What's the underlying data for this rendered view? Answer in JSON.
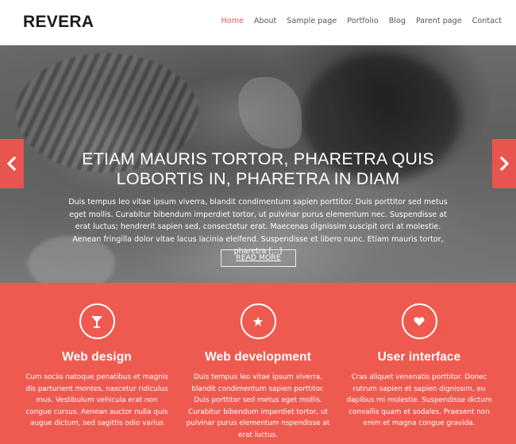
{
  "header": {
    "logo": "REVERA",
    "nav": [
      "Home",
      "About",
      "Sample page",
      "Portfolio",
      "Blog",
      "Parent page",
      "Contact"
    ],
    "active_index": 0
  },
  "slider": {
    "title": "ETIAM MAURIS TORTOR, PHARETRA QUIS LOBORTIS IN, PHARETRA IN DIAM",
    "text": "Duis tempus leo vitae ipsum viverra, blandit condimentum sapien porttitor. Duis porttitor sed metus eget mollis. Curabitur bibendum imperdiet tortor, ut pulvinar purus elementum nec. Suspendisse at erat luctus; hendrerit sapien sed, consectetur erat. Maecenas dignissim suscipit orci at molestie. Aenean fringilla dolor vitae lacus lacinia eleifend. Suspendisse et libero nunc. Etiam mauris tortor, pharetra […]",
    "button": "READ MORE",
    "prev_icon": "chevron-left-icon",
    "next_icon": "chevron-right-icon"
  },
  "features": [
    {
      "icon": "cocktail-glass-icon",
      "title": "Web design",
      "text": "Cum sociis natoque penatibus et magnis dis parturient montes, nascetur ridiculus mus. Vestibulum vehicula erat non congue cursus. Aenean auctor nulla quis augue dictum, sed sagittis odio varius"
    },
    {
      "icon": "star-icon",
      "title": "Web development",
      "text": "Duis tempus leo vitae ipsum viverra, blandit condimentum sapien porttitor. Duis porttitor sed metus eget mollis. Curabitur bibendum imperdiet tortor, ut pulvinar purus elementum nspendisse at erat luctus."
    },
    {
      "icon": "heart-icon",
      "title": "User interface",
      "text": "Cras aliquet venenatis porttitor. Donec rutrum sapien et sapien dignissim, eu dapibus mi molestie. Suspendisse dictum convallis quam et sodales. Praesent non enim et magna congue gravida."
    }
  ],
  "colors": {
    "accent": "#e8554e",
    "features_bg": "#ef5a50",
    "text": "#333333"
  }
}
